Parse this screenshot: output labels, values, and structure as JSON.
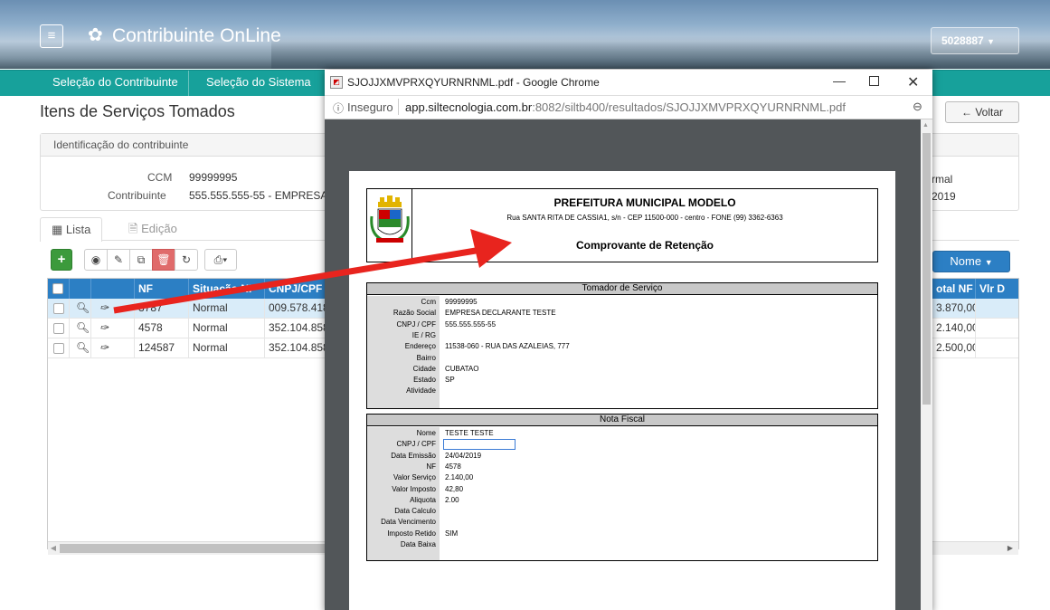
{
  "header": {
    "title": "Contribuinte OnLine",
    "user": "5028887",
    "menu_icon": "hamburger-icon",
    "gear_icon": "gear-icon"
  },
  "nav": {
    "items": [
      "Seleção do Contribuinte",
      "Seleção do Sistema"
    ]
  },
  "page": {
    "title": "Itens de Serviços Tomados",
    "back_label": "Voltar"
  },
  "panel": {
    "header": "Identificação do contribuinte",
    "ccm_label": "CCM",
    "ccm_value": "99999995",
    "contrib_label": "Contribuinte",
    "contrib_value": "555.555.555-55 - EMPRESA",
    "right_value1": "rmal",
    "right_value2": "2019"
  },
  "tabs": {
    "lista": "Lista",
    "edicao": "Edição"
  },
  "toolbar": {
    "nome_label": "Nome"
  },
  "grid": {
    "columns": [
      "NF",
      "Situação NF",
      "CNPJ/CPF",
      "otal NF",
      "Vlr D"
    ],
    "rows": [
      {
        "nf": "3787",
        "situacao": "Normal",
        "cnpj": "009.578.418",
        "total": "3.870,00"
      },
      {
        "nf": "4578",
        "situacao": "Normal",
        "cnpj": "352.104.858",
        "total": "2.140,00"
      },
      {
        "nf": "124587",
        "situacao": "Normal",
        "cnpj": "352.104.858",
        "total": "2.500,00"
      }
    ]
  },
  "chrome": {
    "title": "SJOJJXMVPRXQYURNRNML.pdf - Google Chrome",
    "insecure": "Inseguro",
    "url_host": "app.siltecnologia.com.br",
    "url_rest": ":8082/siltb400/resultados/SJOJJXMVPRXQYURNRNML.pdf"
  },
  "pdf": {
    "org": "PREFEITURA MUNICIPAL MODELO",
    "address": "Rua SANTA RITA DE CASSIA1, s/n - CEP 11500-000 - centro - FONE (99) 3362-6363",
    "doc_title": "Comprovante de Retenção",
    "tomador": {
      "header": "Tomador de Serviço",
      "fields": [
        {
          "label": "Ccm",
          "value": "99999995"
        },
        {
          "label": "Razão Social",
          "value": "EMPRESA DECLARANTE TESTE"
        },
        {
          "label": "CNPJ / CPF",
          "value": "555.555.555-55"
        },
        {
          "label": "IE / RG",
          "value": ""
        },
        {
          "label": "Endereço",
          "value": "11538-060 - RUA DAS AZALEIAS, 777"
        },
        {
          "label": "Bairro",
          "value": ""
        },
        {
          "label": "Cidade",
          "value": "CUBATAO"
        },
        {
          "label": "Estado",
          "value": "SP"
        },
        {
          "label": "Atividade",
          "value": ""
        }
      ]
    },
    "nota": {
      "header": "Nota Fiscal",
      "fields": [
        {
          "label": "Nome",
          "value": "TESTE TESTE"
        },
        {
          "label": "CNPJ / CPF",
          "value": ""
        },
        {
          "label": "Data Emissão",
          "value": "24/04/2019"
        },
        {
          "label": "NF",
          "value": "4578"
        },
        {
          "label": "Valor Serviço",
          "value": "2.140,00"
        },
        {
          "label": "Valor Imposto",
          "value": "42,80"
        },
        {
          "label": "Aliquota",
          "value": "2.00"
        },
        {
          "label": "Data Calculo",
          "value": ""
        },
        {
          "label": "Data Vencimento",
          "value": ""
        },
        {
          "label": "Imposto Retido",
          "value": "SIM"
        },
        {
          "label": "Data Baixa",
          "value": ""
        }
      ]
    }
  },
  "colors": {
    "nav": "#17a19b",
    "grid_header": "#2c7fc4",
    "add": "#3c9a3c",
    "delete": "#e06b6b",
    "arrow": "#e8241e"
  }
}
